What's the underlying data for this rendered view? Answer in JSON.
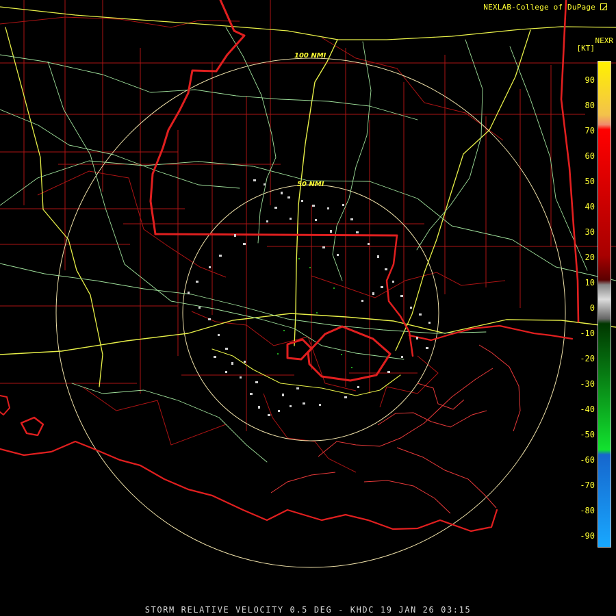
{
  "header": {
    "credit": "NEXLAB-College of DuPage",
    "product": "NEXR",
    "unit": "[KT]"
  },
  "map": {
    "range_rings": [
      "100 NMI",
      "50 NMI"
    ],
    "legend_ticks": [
      "90",
      "80",
      "70",
      "60",
      "50",
      "40",
      "30",
      "20",
      "10",
      "0",
      "-10",
      "-20",
      "-30",
      "-40",
      "-50",
      "-60",
      "-70",
      "-80",
      "-90"
    ],
    "icon": "external-link-icon"
  },
  "footer": {
    "caption": "STORM RELATIVE VELOCITY 0.5 DEG - KHDC 19 JAN 26 03:15"
  },
  "colors": {
    "background": "#000000",
    "boundaries": "#d21919",
    "roads_yellow": "#e7ef48",
    "roads_green": "#9fe09b",
    "rings": "#eee0a8",
    "echoes": "#cfcfcf",
    "velocity_green": "#20a51e"
  }
}
